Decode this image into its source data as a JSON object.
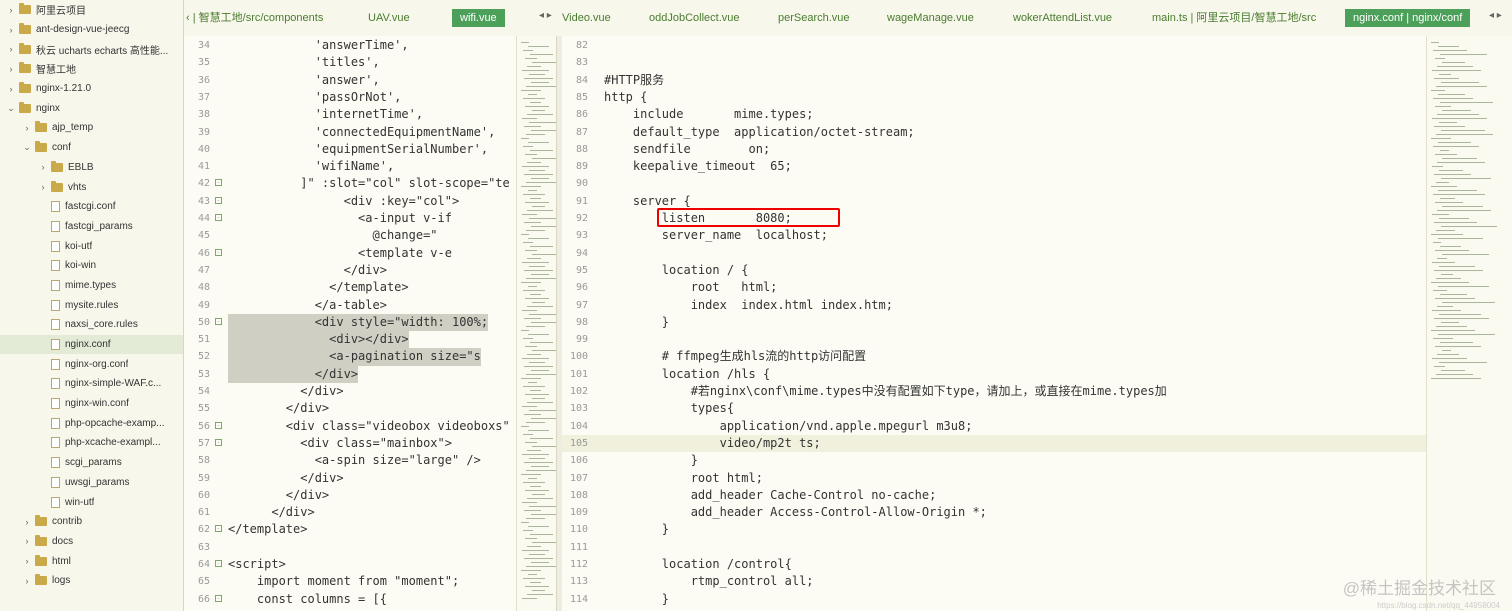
{
  "sidebar": {
    "items": [
      {
        "label": "阿里云项目",
        "depth": 0,
        "type": "folder",
        "expanded": false
      },
      {
        "label": "ant-design-vue-jeecg",
        "depth": 0,
        "type": "folder",
        "expanded": false
      },
      {
        "label": "秋云 ucharts echarts 高性能...",
        "depth": 0,
        "type": "folder",
        "expanded": false
      },
      {
        "label": "智慧工地",
        "depth": 0,
        "type": "folder",
        "expanded": false
      },
      {
        "label": "nginx-1.21.0",
        "depth": 0,
        "type": "folder",
        "expanded": false
      },
      {
        "label": "nginx",
        "depth": 0,
        "type": "folder",
        "expanded": true
      },
      {
        "label": "ajp_temp",
        "depth": 1,
        "type": "folder",
        "expanded": false
      },
      {
        "label": "conf",
        "depth": 1,
        "type": "folder",
        "expanded": true
      },
      {
        "label": "EBLB",
        "depth": 2,
        "type": "folder",
        "expanded": false
      },
      {
        "label": "vhts",
        "depth": 2,
        "type": "folder",
        "expanded": false
      },
      {
        "label": "fastcgi.conf",
        "depth": 2,
        "type": "file"
      },
      {
        "label": "fastcgi_params",
        "depth": 2,
        "type": "file"
      },
      {
        "label": "koi-utf",
        "depth": 2,
        "type": "file"
      },
      {
        "label": "koi-win",
        "depth": 2,
        "type": "file"
      },
      {
        "label": "mime.types",
        "depth": 2,
        "type": "file"
      },
      {
        "label": "mysite.rules",
        "depth": 2,
        "type": "file"
      },
      {
        "label": "naxsi_core.rules",
        "depth": 2,
        "type": "file"
      },
      {
        "label": "nginx.conf",
        "depth": 2,
        "type": "file",
        "selected": true
      },
      {
        "label": "nginx-org.conf",
        "depth": 2,
        "type": "file"
      },
      {
        "label": "nginx-simple-WAF.c...",
        "depth": 2,
        "type": "file"
      },
      {
        "label": "nginx-win.conf",
        "depth": 2,
        "type": "file"
      },
      {
        "label": "php-opcache-examp...",
        "depth": 2,
        "type": "file"
      },
      {
        "label": "php-xcache-exampl...",
        "depth": 2,
        "type": "file"
      },
      {
        "label": "scgi_params",
        "depth": 2,
        "type": "file"
      },
      {
        "label": "uwsgi_params",
        "depth": 2,
        "type": "file"
      },
      {
        "label": "win-utf",
        "depth": 2,
        "type": "file"
      },
      {
        "label": "contrib",
        "depth": 1,
        "type": "folder",
        "expanded": false
      },
      {
        "label": "docs",
        "depth": 1,
        "type": "folder",
        "expanded": false
      },
      {
        "label": "html",
        "depth": 1,
        "type": "folder",
        "expanded": false
      },
      {
        "label": "logs",
        "depth": 1,
        "type": "folder",
        "expanded": false
      }
    ]
  },
  "tabs": {
    "pane1": [
      "‹ | 智慧工地/src/components",
      "UAV.vue",
      "wifi.vue"
    ],
    "pane2": [
      "Video.vue",
      "oddJobCollect.vue",
      "perSearch.vue",
      "wageManage.vue",
      "wokerAttendList.vue",
      "main.ts | 阿里云项目/智慧工地/src",
      "nginx.conf | nginx/conf"
    ],
    "arrows_left": "◂ ▸",
    "arrows_right": "◂ ▸"
  },
  "editor1": {
    "lines": [
      {
        "n": "34",
        "text": "            'answerTime',"
      },
      {
        "n": "35",
        "text": "            'titles',"
      },
      {
        "n": "36",
        "text": "            'answer',"
      },
      {
        "n": "37",
        "text": "            'passOrNot',"
      },
      {
        "n": "38",
        "text": "            'internetTime',"
      },
      {
        "n": "39",
        "text": "            'connectedEquipmentName',"
      },
      {
        "n": "40",
        "text": "            'equipmentSerialNumber',"
      },
      {
        "n": "41",
        "text": "            'wifiName',"
      },
      {
        "n": "42",
        "text": "          ]\" :slot=\"col\" slot-scope=\"te",
        "fold": "-"
      },
      {
        "n": "43",
        "text": "                <div :key=\"col\">",
        "fold": "-"
      },
      {
        "n": "44",
        "text": "                  <a-input v-if",
        "fold": "-"
      },
      {
        "n": "45",
        "text": "                    @change=\""
      },
      {
        "n": "46",
        "text": "                  <template v-e",
        "fold": "-"
      },
      {
        "n": "47",
        "text": "                </div>"
      },
      {
        "n": "48",
        "text": "              </template>"
      },
      {
        "n": "49",
        "text": "            </a-table>"
      },
      {
        "n": "50",
        "text": "            <div style=\"width: 100%;",
        "fold": "-",
        "hl": true
      },
      {
        "n": "51",
        "text": "              <div></div>",
        "hl": true
      },
      {
        "n": "52",
        "text": "              <a-pagination size=\"s",
        "hl": true
      },
      {
        "n": "53",
        "text": "            </div>",
        "hl": true
      },
      {
        "n": "54",
        "text": "          </div>"
      },
      {
        "n": "55",
        "text": "        </div>"
      },
      {
        "n": "56",
        "text": "        <div class=\"videobox videoboxs\" l",
        "fold": "-"
      },
      {
        "n": "57",
        "text": "          <div class=\"mainbox\">",
        "fold": "-"
      },
      {
        "n": "58",
        "text": "            <a-spin size=\"large\" />"
      },
      {
        "n": "59",
        "text": "          </div>"
      },
      {
        "n": "60",
        "text": "        </div>"
      },
      {
        "n": "61",
        "text": "      </div>"
      },
      {
        "n": "62",
        "text": "</template>",
        "fold": "-"
      },
      {
        "n": "63",
        "text": ""
      },
      {
        "n": "64",
        "text": "<script>",
        "fold": "-"
      },
      {
        "n": "65",
        "text": "    import moment from \"moment\";"
      },
      {
        "n": "66",
        "text": "    const columns = [{",
        "fold": "-"
      }
    ]
  },
  "editor2": {
    "lines": [
      {
        "n": "82",
        "text": ""
      },
      {
        "n": "83",
        "text": ""
      },
      {
        "n": "84",
        "text": "#HTTP服务"
      },
      {
        "n": "85",
        "text": "http {"
      },
      {
        "n": "86",
        "text": "    include       mime.types;"
      },
      {
        "n": "87",
        "text": "    default_type  application/octet-stream;"
      },
      {
        "n": "88",
        "text": "    sendfile        on;"
      },
      {
        "n": "89",
        "text": "    keepalive_timeout  65;"
      },
      {
        "n": "90",
        "text": ""
      },
      {
        "n": "91",
        "text": "    server {"
      },
      {
        "n": "92",
        "text": "        listen       8080;"
      },
      {
        "n": "93",
        "text": "        server_name  localhost;"
      },
      {
        "n": "94",
        "text": ""
      },
      {
        "n": "95",
        "text": "        location / {"
      },
      {
        "n": "96",
        "text": "            root   html;"
      },
      {
        "n": "97",
        "text": "            index  index.html index.htm;"
      },
      {
        "n": "98",
        "text": "        }"
      },
      {
        "n": "99",
        "text": ""
      },
      {
        "n": "100",
        "text": "        # ffmpeg生成hls流的http访问配置"
      },
      {
        "n": "101",
        "text": "        location /hls {"
      },
      {
        "n": "102",
        "text": "            #若nginx\\conf\\mime.types中没有配置如下type，请加上，或直接在mime.types加"
      },
      {
        "n": "103",
        "text": "            types{"
      },
      {
        "n": "104",
        "text": "                application/vnd.apple.mpegurl m3u8;"
      },
      {
        "n": "105",
        "text": "                video/mp2t ts;",
        "cur": true
      },
      {
        "n": "106",
        "text": "            }"
      },
      {
        "n": "107",
        "text": "            root html;"
      },
      {
        "n": "108",
        "text": "            add_header Cache-Control no-cache;"
      },
      {
        "n": "109",
        "text": "            add_header Access-Control-Allow-Origin *;"
      },
      {
        "n": "110",
        "text": "        }"
      },
      {
        "n": "111",
        "text": ""
      },
      {
        "n": "112",
        "text": "        location /control{"
      },
      {
        "n": "113",
        "text": "            rtmp_control all;"
      },
      {
        "n": "114",
        "text": "        }"
      }
    ]
  },
  "watermark": {
    "text": "@稀土掘金技术社区",
    "url": "https://blog.csdn.net/qq_44958004"
  },
  "colors": {
    "accent": "#4da05a",
    "highlight": "#e00000"
  }
}
